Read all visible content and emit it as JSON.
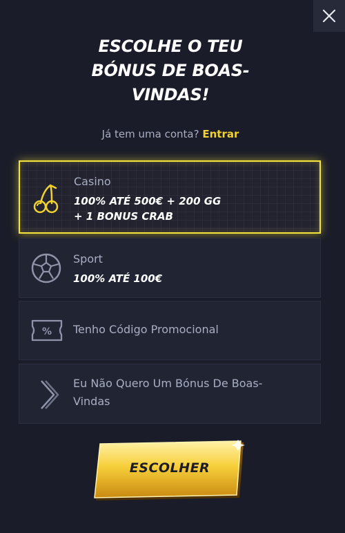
{
  "title_lines": [
    "ESCOLHE O TEU",
    "BÓNUS DE BOAS-",
    "VINDAS!"
  ],
  "account": {
    "question": "Já tem uma conta?",
    "login_label": "Entrar"
  },
  "options": [
    {
      "label": "Casino",
      "offer_lines": [
        "100% ATÉ 500€ + 200 GG",
        "+ 1 BONUS CRAB"
      ],
      "icon": "cherries-icon",
      "selected": true
    },
    {
      "label": "Sport",
      "offer_lines": [
        "100% ATÉ 100€"
      ],
      "icon": "soccer-ball-icon",
      "selected": false
    },
    {
      "label": "Tenho Código Promocional",
      "icon": "percent-ticket-icon",
      "selected": false
    },
    {
      "label_lines": [
        "Eu Não Quero Um Bónus De Boas-",
        "Vindas"
      ],
      "icon": "chevron-right-icon",
      "selected": false
    }
  ],
  "cta_label": "ESCOLHER",
  "colors": {
    "background": "#1a1d29",
    "accent": "#f2d22e",
    "card": "#202433",
    "text_muted": "#a9aec2"
  }
}
